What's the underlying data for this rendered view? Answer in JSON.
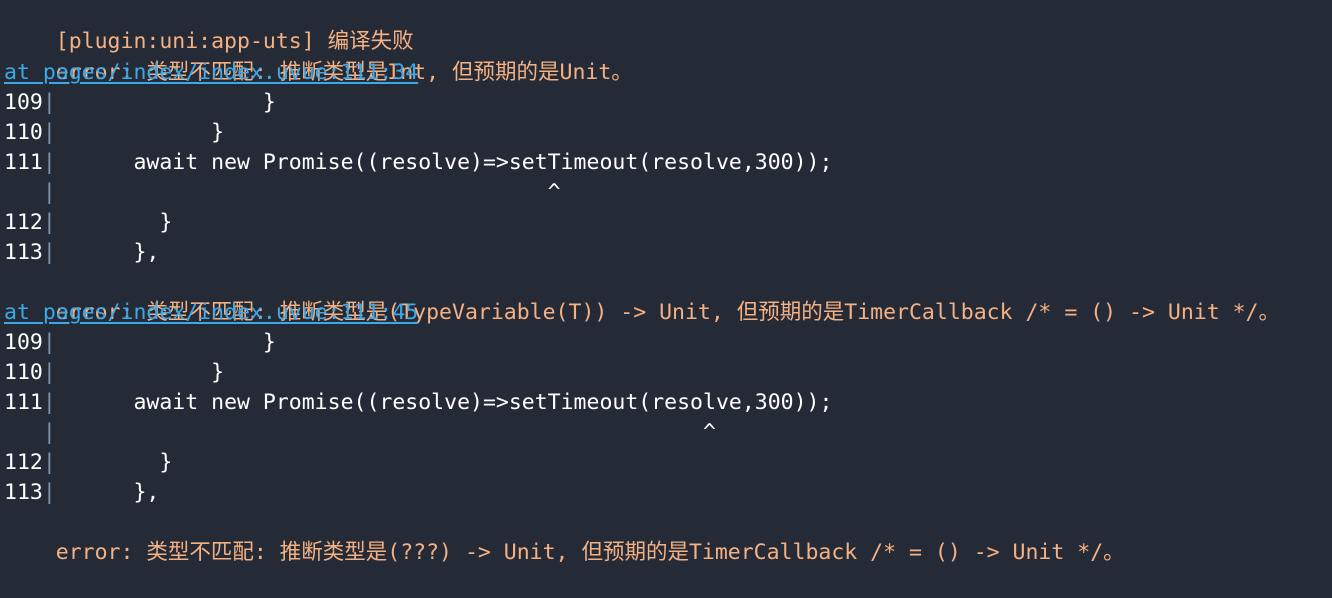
{
  "terminal": {
    "background_color": "#252b36",
    "error_color": "#f5b083",
    "link_color": "#3aa9e8",
    "code_color": "#ffffff",
    "gutter_bar_color": "#7f93ad",
    "header": "[plugin:uni:app-uts] 编译失败",
    "entries": [
      {
        "error_message": "error: 类型不匹配: 推断类型是Int, 但预期的是Unit。",
        "location_link": "at pages/index/index.uvue:111:34",
        "snippet": [
          {
            "num": "109",
            "code": "                }"
          },
          {
            "num": "110",
            "code": "            }"
          },
          {
            "num": "111",
            "code": "      await new Promise((resolve)=>setTimeout(resolve,300));"
          },
          {
            "num": "",
            "code": "                                      ^"
          },
          {
            "num": "112",
            "code": "        }"
          },
          {
            "num": "113",
            "code": "      },"
          }
        ]
      },
      {
        "error_message": "error: 类型不匹配: 推断类型是(TypeVariable(T)) -> Unit, 但预期的是TimerCallback /* = () -> Unit */。",
        "location_link": "at pages/index/index.uvue:111:45",
        "snippet": [
          {
            "num": "109",
            "code": "                }"
          },
          {
            "num": "110",
            "code": "            }"
          },
          {
            "num": "111",
            "code": "      await new Promise((resolve)=>setTimeout(resolve,300));"
          },
          {
            "num": "",
            "code": "                                                  ^"
          },
          {
            "num": "112",
            "code": "        }"
          },
          {
            "num": "113",
            "code": "      },"
          }
        ]
      },
      {
        "error_message": "error: 类型不匹配: 推断类型是(???) -> Unit, 但预期的是TimerCallback /* = () -> Unit */。",
        "location_link": null,
        "snippet": []
      }
    ]
  }
}
